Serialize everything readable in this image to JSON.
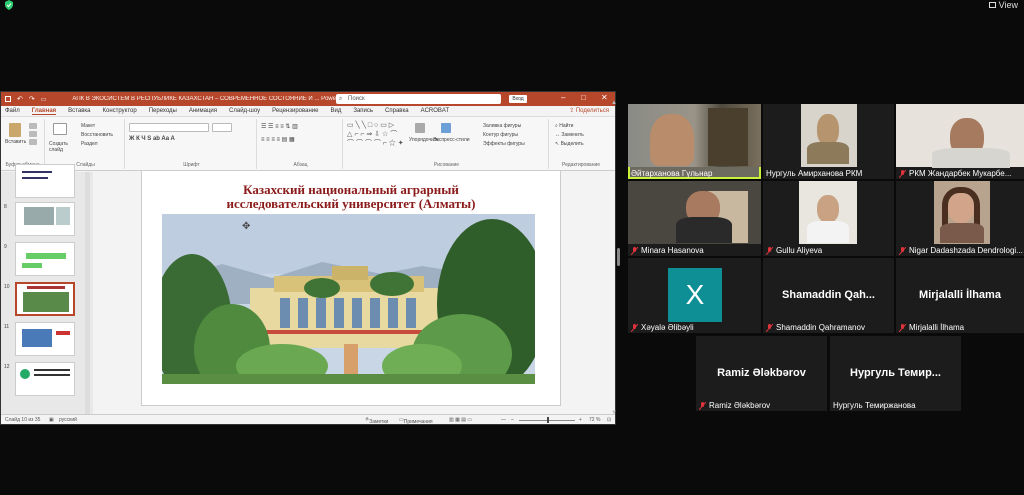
{
  "top": {
    "view_label": "View"
  },
  "ppt": {
    "title": "АПК В ЭКОСИСТЕМ В РЕСПУБЛИКЕ КАЗАХСТАН – СОВРЕМЕННОЕ СОСТОЯНИЕ И ... PowerPoint",
    "search_placeholder": "Поиск",
    "signin": "Вход",
    "share": "Поделиться",
    "tabs": [
      "Файл",
      "Главная",
      "Вставка",
      "Конструктор",
      "Переходы",
      "Анимация",
      "Слайд-шоу",
      "Рецензирование",
      "Вид",
      "Запись",
      "Справка",
      "ACROBAT"
    ],
    "active_tab": "Главная",
    "ribbon": {
      "groups": [
        "Буфер обмена",
        "Слайды",
        "Шрифт",
        "Абзац",
        "Рисование",
        "Редактирование"
      ],
      "paste": "Вставить",
      "create_slide": "Создать слайд",
      "layout": "Макет",
      "reset": "Восстановить",
      "section": "Раздел",
      "arrange": "Упорядочить",
      "quick_styles": "Экспресс-стили",
      "shape_fill": "Заливка фигуры",
      "shape_outline": "Контур фигуры",
      "shape_effects": "Эффекты фигуры",
      "find": "Найти",
      "replace": "Заменить",
      "select": "Выделить"
    },
    "thumb_numbers": [
      "8",
      "9",
      "10",
      "11",
      "12"
    ],
    "slide_title_line1": "Казахский национальный аграрный",
    "slide_title_line2": "исследовательский университет (Алматы)",
    "status_left": "Слайд 10 из 35",
    "status_lang": "русский",
    "status_notes": "Заметки",
    "status_comments": "Примечания",
    "zoom": "72 %"
  },
  "participants": [
    {
      "name": "Әйтарханова Гүльнар",
      "type": "video",
      "muted": false,
      "active": true
    },
    {
      "name": "Нургуль Амирханова РКМ",
      "type": "video",
      "muted": false
    },
    {
      "name": "РКМ Жандарбек Мукарбе...",
      "type": "video",
      "muted": true
    },
    {
      "name": "Minara Hasanova",
      "type": "video",
      "muted": true
    },
    {
      "name": "Gullu Aliyeva",
      "type": "video",
      "muted": true
    },
    {
      "name": "Nigar Dadashzada Dendrologi...",
      "type": "video",
      "muted": true
    },
    {
      "name": "Xəyalə Əlibəyli",
      "type": "avatar",
      "initial": "X",
      "muted": true
    },
    {
      "name": "Shamaddin Qahramanov",
      "type": "text",
      "big": "Shamaddin  Qah...",
      "muted": true
    },
    {
      "name": "Mirjalalli İlhama",
      "type": "text",
      "big": "Mirjalalli  İlhama",
      "muted": true
    },
    {
      "name": "Ramiz Ələkbərov",
      "type": "text",
      "big": "Ramiz Ələkbərov",
      "muted": true
    },
    {
      "name": "Нургуль Темиржанова",
      "type": "text",
      "big": "Нургуль  Темир...",
      "muted": false
    }
  ],
  "colors": {
    "ppt_accent": "#b7472a",
    "active_speaker": "#c9f23a",
    "avatar_bg": "#0e8f95",
    "muted": "#e0333c"
  }
}
